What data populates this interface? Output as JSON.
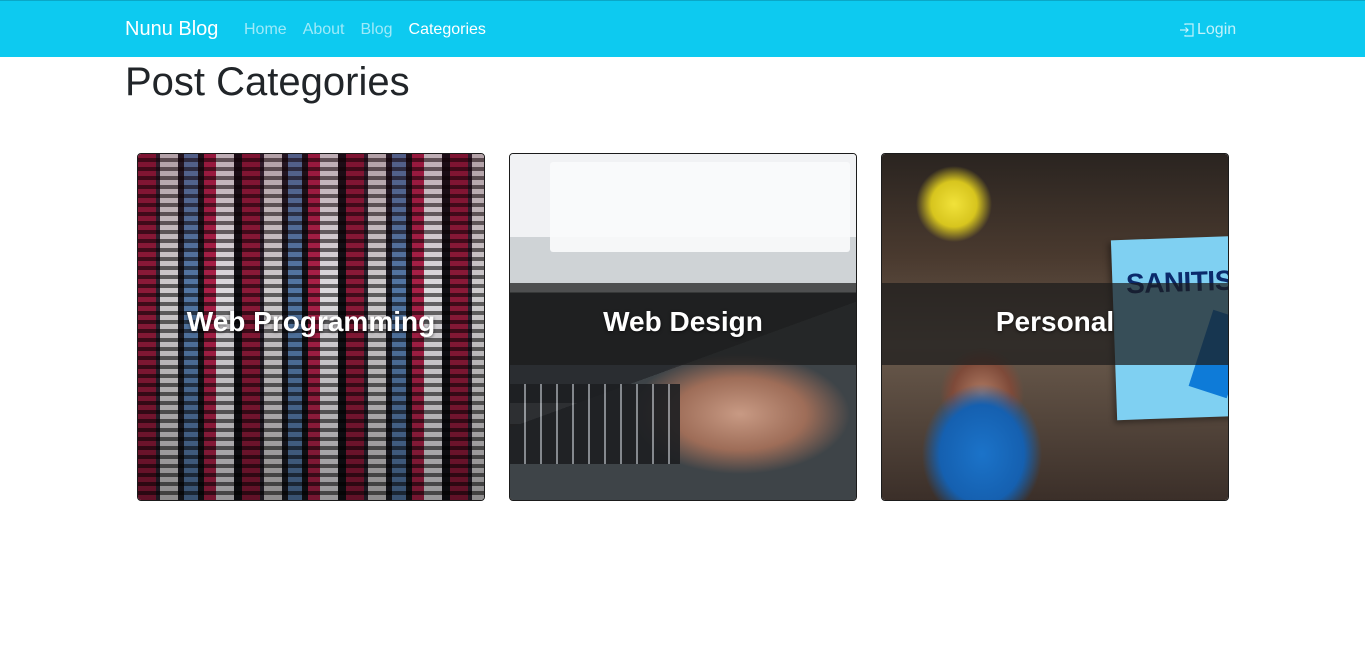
{
  "navbar": {
    "brand": "Nunu Blog",
    "links": [
      "Home",
      "About",
      "Blog",
      "Categories"
    ],
    "active": "Categories",
    "login": "Login",
    "bg_color": "#0dcaf0"
  },
  "page": {
    "title": "Post Categories"
  },
  "categories": [
    {
      "title": "Web Programming",
      "image": "code-on-screen"
    },
    {
      "title": "Web Design",
      "image": "hands-on-laptop"
    },
    {
      "title": "Personal",
      "image": "blurred-market-photo",
      "sign_text": "SANITISIN"
    }
  ]
}
